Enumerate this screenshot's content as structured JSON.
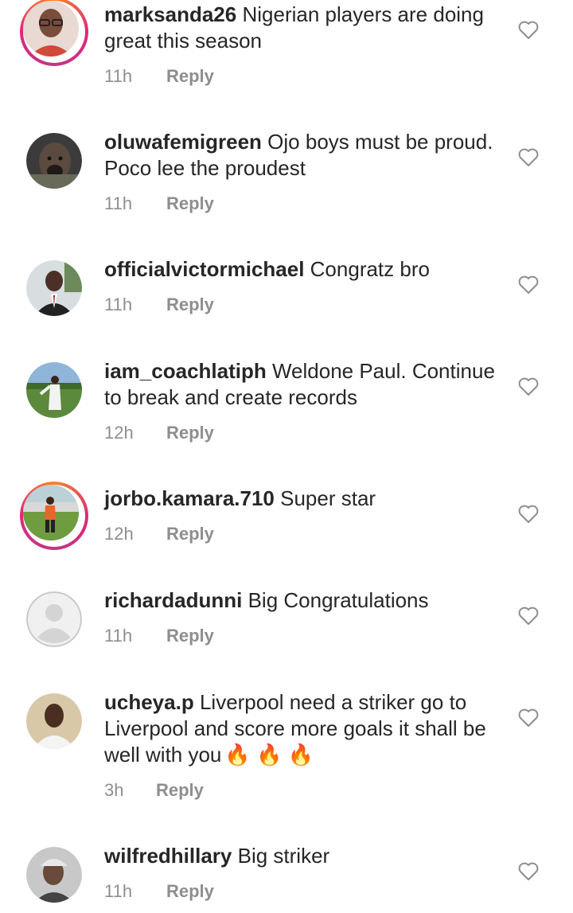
{
  "comments": [
    {
      "username": "marksanda26",
      "text": "Nigerian players are doing great this season",
      "time": "11h",
      "reply_label": "Reply",
      "avatar_icon": "user-avatar-man-glasses",
      "has_story": true
    },
    {
      "username": "oluwafemigreen",
      "text": "Ojo boys must be proud. Poco lee the proudest",
      "time": "11h",
      "reply_label": "Reply",
      "avatar_icon": "user-avatar-dog",
      "has_story": false
    },
    {
      "username": "officialvictormichael",
      "text": "Congratz bro",
      "time": "11h",
      "reply_label": "Reply",
      "avatar_icon": "user-avatar-man-suit",
      "has_story": false
    },
    {
      "username": "iam_coachlatiph",
      "text": "Weldone Paul. Continue to break and create records",
      "time": "12h",
      "reply_label": "Reply",
      "avatar_icon": "user-avatar-man-field",
      "has_story": false
    },
    {
      "username": "jorbo.kamara.710",
      "text": "Super star",
      "time": "12h",
      "reply_label": "Reply",
      "avatar_icon": "user-avatar-footballer",
      "has_story": true
    },
    {
      "username": "richardadunni",
      "text": "Big Congratulations",
      "time": "11h",
      "reply_label": "Reply",
      "avatar_icon": "default-avatar",
      "has_story": false
    },
    {
      "username": "ucheya.p",
      "text": "Liverpool need a striker go to Liverpool and score more goals it shall be well with you",
      "emoji": "🔥 🔥 🔥",
      "time": "3h",
      "reply_label": "Reply",
      "avatar_icon": "user-avatar-man-white",
      "has_story": false
    },
    {
      "username": "wilfredhillary",
      "text": "Big striker",
      "time": "11h",
      "reply_label": "Reply",
      "avatar_icon": "user-avatar-man-cap",
      "has_story": false
    }
  ]
}
